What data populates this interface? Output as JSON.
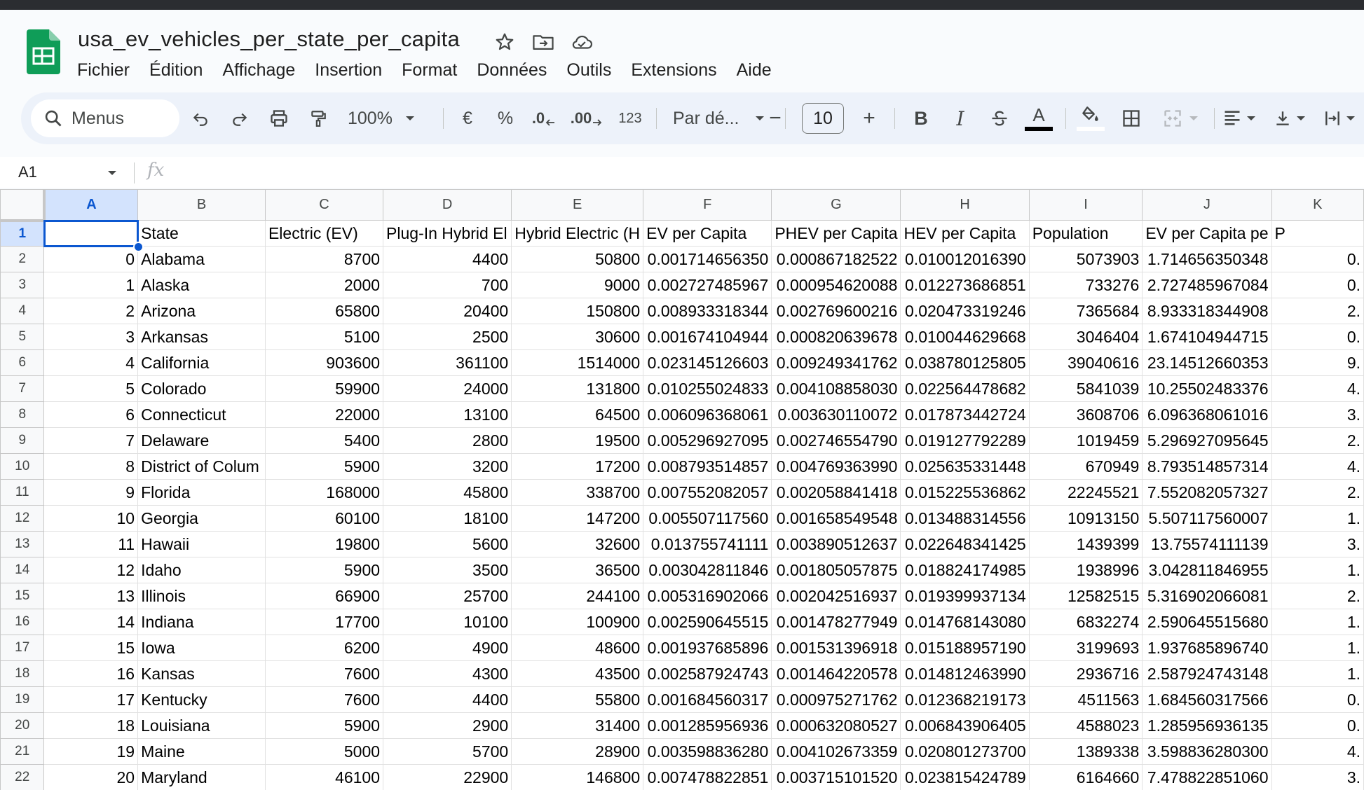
{
  "app": {
    "doc_title": "usa_ev_vehicles_per_state_per_capita",
    "menus": [
      "Fichier",
      "Édition",
      "Affichage",
      "Insertion",
      "Format",
      "Données",
      "Outils",
      "Extensions",
      "Aide"
    ]
  },
  "toolbar": {
    "search_label": "Menus",
    "zoom": "100%",
    "currency": "€",
    "percent": "%",
    "decimal_decrease": ".0",
    "decimal_increase": ".00",
    "number_format": "123",
    "font": "Par dé...",
    "font_size": "10",
    "minus": "−",
    "plus": "+",
    "bold": "B",
    "italic": "I",
    "text_color_letter": "A"
  },
  "formula_bar": {
    "cell_ref": "A1",
    "fx": "fx",
    "value": ""
  },
  "sheet": {
    "columns": [
      "A",
      "B",
      "C",
      "D",
      "E",
      "F",
      "G",
      "H",
      "I",
      "J",
      "K"
    ],
    "header_row": [
      "",
      "State",
      "Electric (EV)",
      "Plug-In Hybrid El",
      "Hybrid Electric (H",
      "EV per Capita",
      "PHEV per Capita",
      "HEV per Capita",
      "Population",
      "EV per Capita pe",
      "P"
    ],
    "rows": [
      [
        "0",
        "Alabama",
        "8700",
        "4400",
        "50800",
        "0.001714656350",
        "0.000867182522",
        "0.010012016390",
        "5073903",
        "1.714656350348",
        "0."
      ],
      [
        "1",
        "Alaska",
        "2000",
        "700",
        "9000",
        "0.002727485967",
        "0.000954620088",
        "0.012273686851",
        "733276",
        "2.727485967084",
        "0."
      ],
      [
        "2",
        "Arizona",
        "65800",
        "20400",
        "150800",
        "0.008933318344",
        "0.002769600216",
        "0.020473319246",
        "7365684",
        "8.933318344908",
        "2."
      ],
      [
        "3",
        "Arkansas",
        "5100",
        "2500",
        "30600",
        "0.001674104944",
        "0.000820639678",
        "0.010044629668",
        "3046404",
        "1.674104944715",
        "0."
      ],
      [
        "4",
        "California",
        "903600",
        "361100",
        "1514000",
        "0.023145126603",
        "0.009249341762",
        "0.038780125805",
        "39040616",
        "23.14512660353",
        "9."
      ],
      [
        "5",
        "Colorado",
        "59900",
        "24000",
        "131800",
        "0.010255024833",
        "0.004108858030",
        "0.022564478682",
        "5841039",
        "10.25502483376",
        "4."
      ],
      [
        "6",
        "Connecticut",
        "22000",
        "13100",
        "64500",
        "0.006096368061",
        "0.003630110072",
        "0.017873442724",
        "3608706",
        "6.096368061016",
        "3."
      ],
      [
        "7",
        "Delaware",
        "5400",
        "2800",
        "19500",
        "0.005296927095",
        "0.002746554790",
        "0.019127792289",
        "1019459",
        "5.296927095645",
        "2."
      ],
      [
        "8",
        "District of Colum",
        "5900",
        "3200",
        "17200",
        "0.008793514857",
        "0.004769363990",
        "0.025635331448",
        "670949",
        "8.793514857314",
        "4."
      ],
      [
        "9",
        "Florida",
        "168000",
        "45800",
        "338700",
        "0.007552082057",
        "0.002058841418",
        "0.015225536862",
        "22245521",
        "7.552082057327",
        "2."
      ],
      [
        "10",
        "Georgia",
        "60100",
        "18100",
        "147200",
        "0.005507117560",
        "0.001658549548",
        "0.013488314556",
        "10913150",
        "5.507117560007",
        "1."
      ],
      [
        "11",
        "Hawaii",
        "19800",
        "5600",
        "32600",
        "0.013755741111",
        "0.003890512637",
        "0.022648341425",
        "1439399",
        "13.75574111139",
        "3."
      ],
      [
        "12",
        "Idaho",
        "5900",
        "3500",
        "36500",
        "0.003042811846",
        "0.001805057875",
        "0.018824174985",
        "1938996",
        "3.042811846955",
        "1."
      ],
      [
        "13",
        "Illinois",
        "66900",
        "25700",
        "244100",
        "0.005316902066",
        "0.002042516937",
        "0.019399937134",
        "12582515",
        "5.316902066081",
        "2."
      ],
      [
        "14",
        "Indiana",
        "17700",
        "10100",
        "100900",
        "0.002590645515",
        "0.001478277949",
        "0.014768143080",
        "6832274",
        "2.590645515680",
        "1."
      ],
      [
        "15",
        "Iowa",
        "6200",
        "4900",
        "48600",
        "0.001937685896",
        "0.001531396918",
        "0.015188957190",
        "3199693",
        "1.937685896740",
        "1."
      ],
      [
        "16",
        "Kansas",
        "7600",
        "4300",
        "43500",
        "0.002587924743",
        "0.001464220578",
        "0.014812463990",
        "2936716",
        "2.587924743148",
        "1."
      ],
      [
        "17",
        "Kentucky",
        "7600",
        "4400",
        "55800",
        "0.001684560317",
        "0.000975271762",
        "0.012368219173",
        "4511563",
        "1.684560317566",
        "0."
      ],
      [
        "18",
        "Louisiana",
        "5900",
        "2900",
        "31400",
        "0.001285956936",
        "0.000632080527",
        "0.006843906405",
        "4588023",
        "1.285956936135",
        "0."
      ],
      [
        "19",
        "Maine",
        "5000",
        "5700",
        "28900",
        "0.003598836280",
        "0.004102673359",
        "0.020801273700",
        "1389338",
        "3.598836280300",
        "4."
      ],
      [
        "20",
        "Maryland",
        "46100",
        "22900",
        "146800",
        "0.007478822851",
        "0.003715101520",
        "0.023815424789",
        "6164660",
        "7.478822851060",
        "3."
      ]
    ]
  }
}
